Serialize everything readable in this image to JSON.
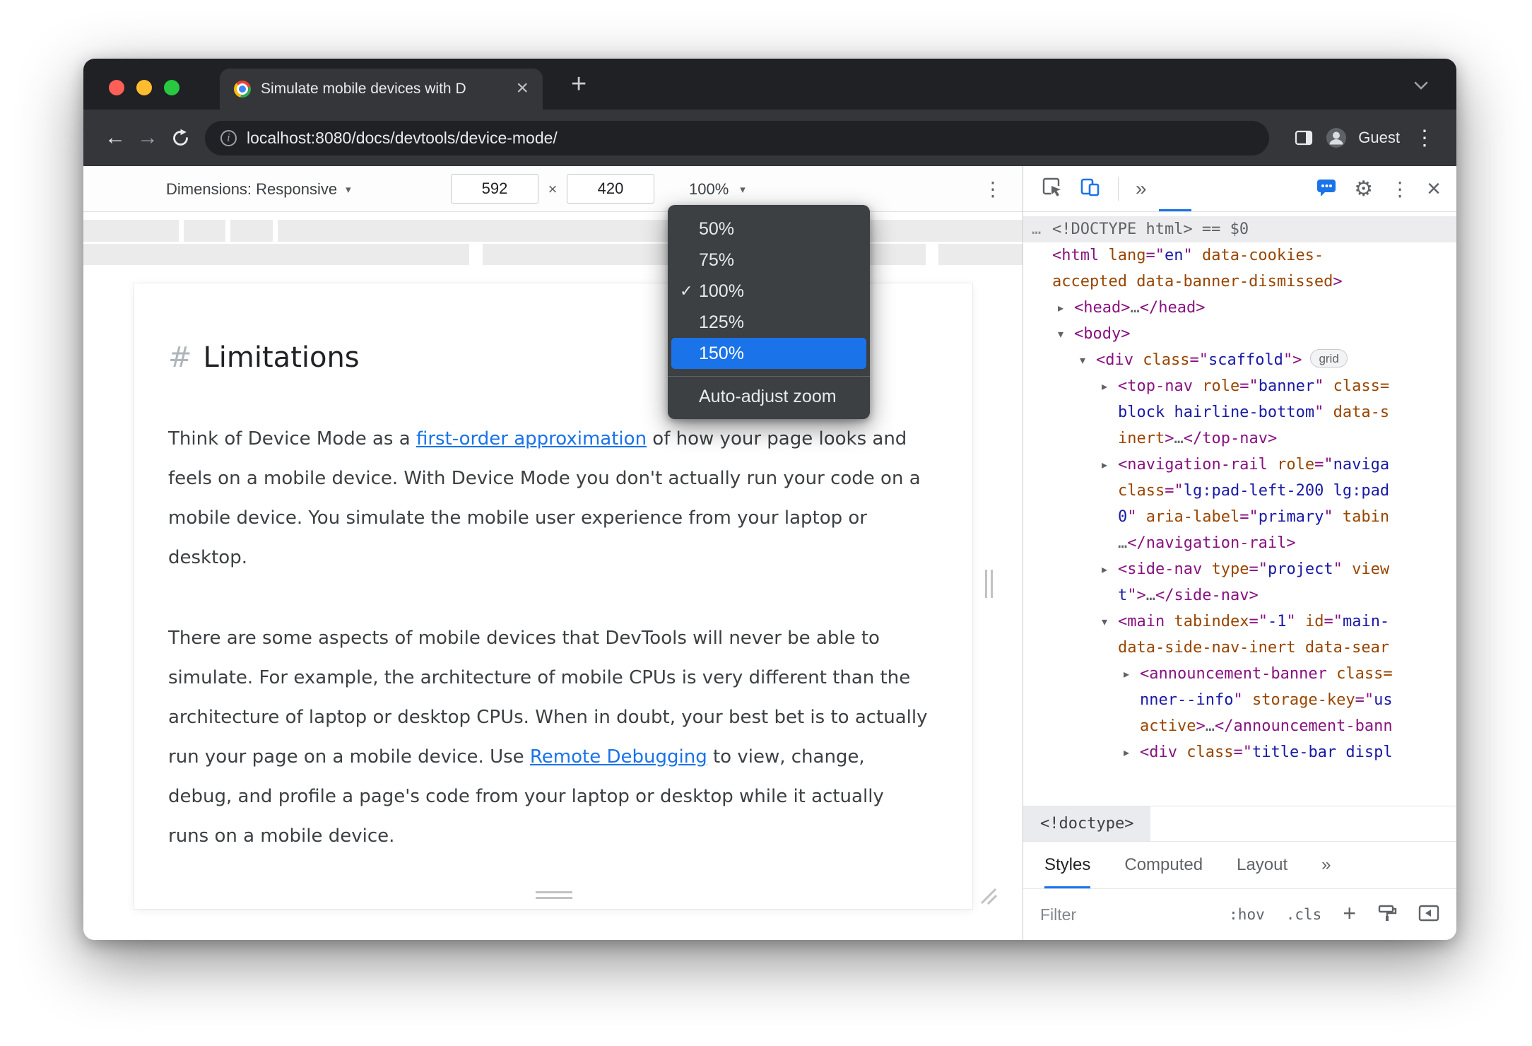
{
  "window": {
    "tab_title": "Simulate mobile devices with D",
    "url": "localhost:8080/docs/devtools/device-mode/",
    "guest_label": "Guest",
    "new_tab": "+"
  },
  "icons": {
    "caret_down": "▾",
    "close": "×",
    "kebab": "⋮",
    "back_arrow": "←",
    "forward_arrow": "→",
    "more_chevrons": "»",
    "gear": "⚙",
    "check": "✓"
  },
  "device_toolbar": {
    "dimensions_label": "Dimensions: Responsive",
    "width_value": "592",
    "multiply": "×",
    "height_value": "420",
    "zoom_value": "100%"
  },
  "zoom_menu": {
    "items": [
      {
        "label": "50%"
      },
      {
        "label": "75%"
      },
      {
        "label": "100%",
        "checked": true
      },
      {
        "label": "125%"
      },
      {
        "label": "150%",
        "highlighted": true
      }
    ],
    "auto_adjust": "Auto-adjust zoom"
  },
  "page": {
    "heading_marker": "#",
    "heading": "Limitations",
    "para1": [
      {
        "text": "Think of Device Mode as a "
      },
      {
        "text": "first-order approximation",
        "link": true
      },
      {
        "text": " of how your page looks and feels on a mobile device. With Device Mode you don't actually run your code on a mobile device. You simulate the mobile user experience from your laptop or desktop."
      }
    ],
    "para2": [
      {
        "text": "There are some aspects of mobile devices that DevTools will never be able to simulate. For example, the architecture of mobile CPUs is very different than the architecture of laptop or desktop CPUs. When in doubt, your best bet is to actually run your page on a mobile device. Use "
      },
      {
        "text": "Remote Debugging",
        "link": true
      },
      {
        "text": " to view, change, debug, and profile a page's code from your laptop or desktop while it actually runs on a mobile device."
      }
    ]
  },
  "devtools": {
    "tree": [
      {
        "sel": true,
        "gutter": "…",
        "indent": 0,
        "tokens": [
          [
            "g",
            "<!DOCTYPE html>"
          ],
          [
            "g",
            " == $0"
          ]
        ]
      },
      {
        "indent": 0,
        "tokens": [
          [
            "t",
            "<html"
          ],
          [
            "a",
            " lang"
          ],
          [
            "t",
            "=\""
          ],
          [
            "v",
            "en"
          ],
          [
            "t",
            "\""
          ],
          [
            "a",
            " data-cookies-"
          ]
        ]
      },
      {
        "indent": 0,
        "tokens": [
          [
            "a",
            "accepted"
          ],
          [
            "a",
            " data-banner-dismissed"
          ],
          [
            "t",
            ">"
          ]
        ]
      },
      {
        "indent": 1,
        "arrow": "r",
        "tokens": [
          [
            "t",
            "<head>"
          ],
          [
            "g",
            "…"
          ],
          [
            "t",
            "</head>"
          ]
        ]
      },
      {
        "indent": 1,
        "arrow": "d",
        "tokens": [
          [
            "t",
            "<body>"
          ]
        ]
      },
      {
        "indent": 2,
        "arrow": "d",
        "badge": "grid",
        "tokens": [
          [
            "t",
            "<div"
          ],
          [
            "a",
            " class"
          ],
          [
            "t",
            "=\""
          ],
          [
            "v",
            "scaffold"
          ],
          [
            "t",
            "\">"
          ]
        ]
      },
      {
        "indent": 3,
        "arrow": "r",
        "tokens": [
          [
            "t",
            "<top-nav"
          ],
          [
            "a",
            " role"
          ],
          [
            "t",
            "=\""
          ],
          [
            "v",
            "banner"
          ],
          [
            "t",
            "\""
          ],
          [
            "a",
            " class="
          ]
        ]
      },
      {
        "indent": 3,
        "tokens": [
          [
            "v",
            "block hairline-bottom"
          ],
          [
            "t",
            "\""
          ],
          [
            "a",
            " data-s"
          ]
        ]
      },
      {
        "indent": 3,
        "tokens": [
          [
            "a",
            "inert"
          ],
          [
            "t",
            ">"
          ],
          [
            "g",
            "…"
          ],
          [
            "t",
            "</top-nav>"
          ]
        ]
      },
      {
        "indent": 3,
        "arrow": "r",
        "tokens": [
          [
            "t",
            "<navigation-rail"
          ],
          [
            "a",
            " role"
          ],
          [
            "t",
            "=\""
          ],
          [
            "v",
            "naviga"
          ]
        ]
      },
      {
        "indent": 3,
        "tokens": [
          [
            "a",
            "class"
          ],
          [
            "t",
            "=\""
          ],
          [
            "v",
            "lg:pad-left-200 lg:pad"
          ]
        ]
      },
      {
        "indent": 3,
        "tokens": [
          [
            "v",
            "0"
          ],
          [
            "t",
            "\""
          ],
          [
            "a",
            " aria-label"
          ],
          [
            "t",
            "=\""
          ],
          [
            "v",
            "primary"
          ],
          [
            "t",
            "\""
          ],
          [
            "a",
            " tabin"
          ]
        ]
      },
      {
        "indent": 3,
        "tokens": [
          [
            "g",
            "…"
          ],
          [
            "t",
            "</navigation-rail>"
          ]
        ]
      },
      {
        "indent": 3,
        "arrow": "r",
        "tokens": [
          [
            "t",
            "<side-nav"
          ],
          [
            "a",
            " type"
          ],
          [
            "t",
            "=\""
          ],
          [
            "v",
            "project"
          ],
          [
            "t",
            "\""
          ],
          [
            "a",
            " view"
          ]
        ]
      },
      {
        "indent": 3,
        "tokens": [
          [
            "v",
            "t"
          ],
          [
            "t",
            "\">"
          ],
          [
            "g",
            "…"
          ],
          [
            "t",
            "</side-nav>"
          ]
        ]
      },
      {
        "indent": 3,
        "arrow": "d",
        "tokens": [
          [
            "t",
            "<main"
          ],
          [
            "a",
            " tabindex"
          ],
          [
            "t",
            "=\""
          ],
          [
            "v",
            "-1"
          ],
          [
            "t",
            "\""
          ],
          [
            "a",
            " id"
          ],
          [
            "t",
            "=\""
          ],
          [
            "v",
            "main-"
          ]
        ]
      },
      {
        "indent": 3,
        "tokens": [
          [
            "a",
            "data-side-nav-inert"
          ],
          [
            "a",
            " data-sear"
          ]
        ]
      },
      {
        "indent": 4,
        "arrow": "r",
        "tokens": [
          [
            "t",
            "<announcement-banner"
          ],
          [
            "a",
            " class="
          ]
        ]
      },
      {
        "indent": 4,
        "tokens": [
          [
            "v",
            "nner--info"
          ],
          [
            "t",
            "\""
          ],
          [
            "a",
            " storage-key"
          ],
          [
            "t",
            "=\""
          ],
          [
            "v",
            "us"
          ]
        ]
      },
      {
        "indent": 4,
        "tokens": [
          [
            "a",
            "active"
          ],
          [
            "t",
            ">"
          ],
          [
            "g",
            "…"
          ],
          [
            "t",
            "</announcement-bann"
          ]
        ]
      },
      {
        "indent": 4,
        "arrow": "r",
        "tokens": [
          [
            "t",
            "<div"
          ],
          [
            "a",
            " class"
          ],
          [
            "t",
            "=\""
          ],
          [
            "v",
            "title-bar displ"
          ]
        ]
      }
    ],
    "breadcrumb": "<!doctype>",
    "tabs": [
      {
        "label": "Styles",
        "active": true
      },
      {
        "label": "Computed"
      },
      {
        "label": "Layout"
      },
      {
        "label": "»"
      }
    ],
    "filter_placeholder": "Filter",
    "pseudo_state": ":hov",
    "class_toggle": ".cls",
    "new_rule": "+"
  }
}
